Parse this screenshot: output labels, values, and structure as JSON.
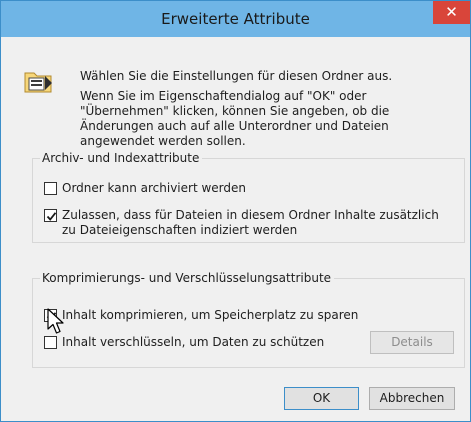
{
  "window": {
    "title": "Erweiterte Attribute",
    "close_glyph": "✕"
  },
  "intro": {
    "line1": "Wählen Sie die Einstellungen für diesen Ordner aus.",
    "line2": "Wenn Sie im Eigenschaftendialog auf \"OK\" oder \"Übernehmen\" klicken, können Sie angeben, ob die Änderungen auch auf alle Unterordner und Dateien angewendet werden sollen."
  },
  "archive_group": {
    "label": "Archiv- und Indexattribute",
    "options": [
      {
        "label": "Ordner kann archiviert werden",
        "checked": false
      },
      {
        "label": "Zulassen, dass für Dateien in diesem Ordner Inhalte zusätzlich zu Dateieigenschaften indiziert werden",
        "checked": true
      }
    ]
  },
  "compress_group": {
    "label": "Komprimierungs- und Verschlüsselungsattribute",
    "options": [
      {
        "label": "Inhalt komprimieren, um Speicherplatz zu sparen",
        "checked": true
      },
      {
        "label": "Inhalt verschlüsseln, um Daten zu schützen",
        "checked": false
      }
    ],
    "details_button": "Details"
  },
  "buttons": {
    "ok": "OK",
    "cancel": "Abbrechen"
  },
  "colors": {
    "titlebar": "#6fb5e6",
    "close": "#d9453a",
    "accent_border": "#3c8ec9"
  },
  "icons": [
    "folder-settings-icon",
    "close-icon",
    "checkmark-icon",
    "mouse-cursor-icon"
  ]
}
